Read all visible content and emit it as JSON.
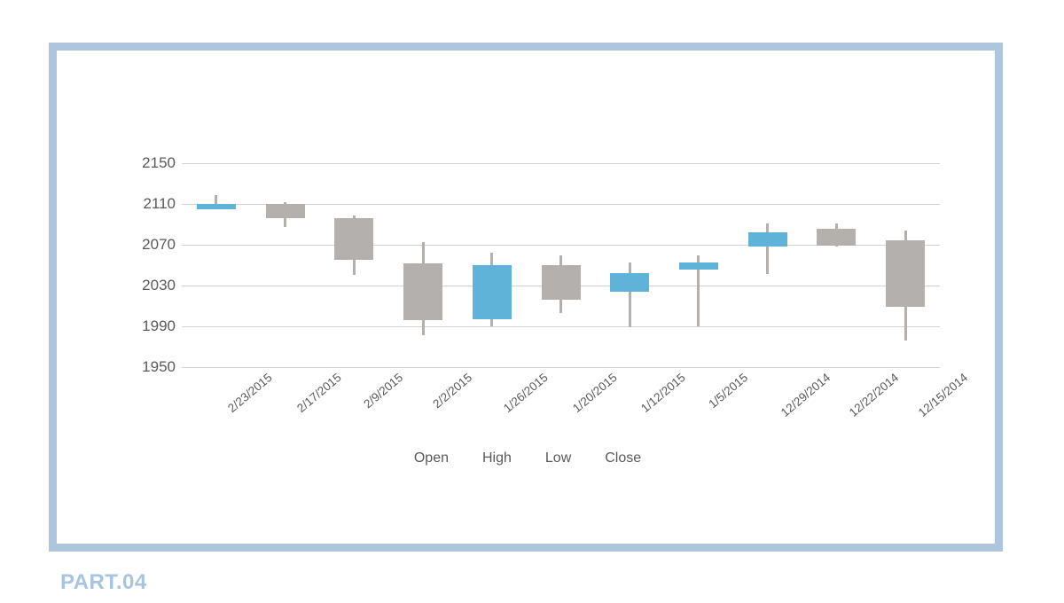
{
  "slide": {
    "part_label": "PART.04",
    "frame_color": "#aec6dd",
    "background": "#ffffff"
  },
  "legend": {
    "items": [
      "Open",
      "High",
      "Low",
      "Close"
    ],
    "position": "bottom-center"
  },
  "chart_data": {
    "type": "candlestick",
    "title": "",
    "xlabel": "",
    "ylabel": "",
    "ylim": [
      1950,
      2150
    ],
    "yticks": [
      2150,
      2110,
      2070,
      2030,
      1990,
      1950
    ],
    "grid": true,
    "up_color": "#5fb3d9",
    "down_color": "#b3b0ae",
    "wick_color": "#b3b0ae",
    "categories": [
      "2/23/2015",
      "2/17/2015",
      "2/9/2015",
      "2/2/2015",
      "1/26/2015",
      "1/20/2015",
      "1/12/2015",
      "1/5/2015",
      "12/29/2014",
      "12/22/2014",
      "12/15/2014"
    ],
    "points": [
      {
        "date": "2/23/2015",
        "open": 2105,
        "high": 2119,
        "low": 2105,
        "close": 2110,
        "direction": "up"
      },
      {
        "date": "2/17/2015",
        "open": 2110,
        "high": 2112,
        "low": 2087,
        "close": 2096,
        "direction": "down"
      },
      {
        "date": "2/9/2015",
        "open": 2096,
        "high": 2099,
        "low": 2040,
        "close": 2055,
        "direction": "down"
      },
      {
        "date": "2/2/2015",
        "open": 2052,
        "high": 2073,
        "low": 1981,
        "close": 1996,
        "direction": "down"
      },
      {
        "date": "1/26/2015",
        "open": 1997,
        "high": 2062,
        "low": 1990,
        "close": 2050,
        "direction": "up"
      },
      {
        "date": "1/20/2015",
        "open": 2050,
        "high": 2060,
        "low": 2003,
        "close": 2016,
        "direction": "down"
      },
      {
        "date": "1/12/2015",
        "open": 2024,
        "high": 2053,
        "low": 1989,
        "close": 2042,
        "direction": "up"
      },
      {
        "date": "1/5/2015",
        "open": 2046,
        "high": 2060,
        "low": 1990,
        "close": 2053,
        "direction": "up"
      },
      {
        "date": "12/29/2014",
        "open": 2068,
        "high": 2091,
        "low": 2041,
        "close": 2082,
        "direction": "up"
      },
      {
        "date": "12/22/2014",
        "open": 2069,
        "high": 2091,
        "low": 2068,
        "close": 2086,
        "direction": "down"
      },
      {
        "date": "12/15/2014",
        "open": 2074,
        "high": 2084,
        "low": 1976,
        "close": 2009,
        "direction": "down"
      }
    ]
  }
}
